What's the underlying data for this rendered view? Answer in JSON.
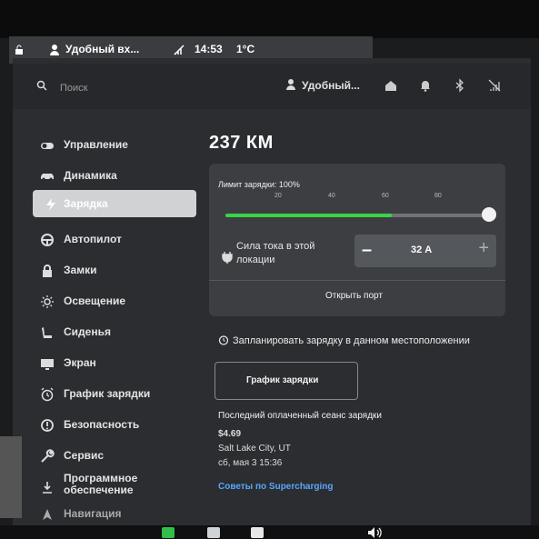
{
  "statusbar": {
    "lock_text": "Удобный вх...",
    "time": "14:53",
    "temperature": "1°C"
  },
  "header": {
    "search_placeholder": "Поиск",
    "user_name": "Удобный..."
  },
  "sidebar": {
    "items": [
      {
        "label": "Управление",
        "icon": "toggle-icon"
      },
      {
        "label": "Динамика",
        "icon": "car-icon"
      },
      {
        "label": "Зарядка",
        "icon": "bolt-icon",
        "active": true
      },
      {
        "label": "Автопилот",
        "icon": "steering-wheel-icon"
      },
      {
        "label": "Замки",
        "icon": "lock-icon"
      },
      {
        "label": "Освещение",
        "icon": "light-icon"
      },
      {
        "label": "Сиденья",
        "icon": "seat-icon"
      },
      {
        "label": "Экран",
        "icon": "screen-icon"
      },
      {
        "label": "График зарядки",
        "icon": "alarm-clock-icon"
      },
      {
        "label": "Безопасность",
        "icon": "safety-icon"
      },
      {
        "label": "Сервис",
        "icon": "wrench-icon"
      },
      {
        "label": "Программное обеспечение",
        "icon": "download-icon"
      },
      {
        "label": "Навигация",
        "icon": "navigation-icon"
      }
    ]
  },
  "charging": {
    "range": "237 КМ",
    "limit_label": "Лимит зарядки: 100%",
    "ticks": [
      "20",
      "40",
      "60",
      "80"
    ],
    "limit_percent": 100,
    "current_level_percent": 63,
    "amps_label": "Сила тока в этой локации",
    "amps_value": "32 А",
    "minus": "–",
    "plus": "+",
    "open_port": "Открыть порт",
    "schedule_text": "Запланировать зарядку в данном местоположении",
    "schedule_button": "График зарядки",
    "last_session_title": "Последний оплаченный сеанс зарядки",
    "last_session_amount": "$4.69",
    "last_session_location": "Salt Lake City, UT",
    "last_session_date": "сб, мая 3 15:36",
    "tips_link": "Советы по Supercharging"
  },
  "colors": {
    "accent_green": "#39d447",
    "link_blue": "#5aa6ff",
    "active_item_bg": "#d0d2d4"
  }
}
